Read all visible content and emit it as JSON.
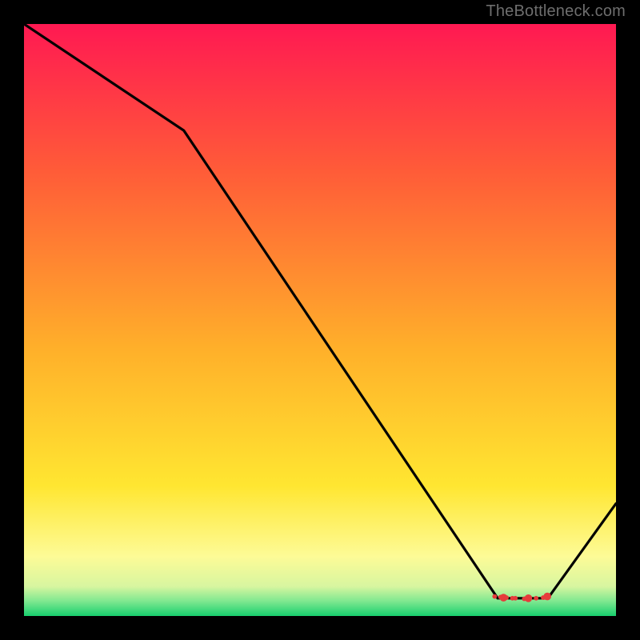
{
  "attribution": "TheBottleneck.com",
  "chart_data": {
    "type": "line",
    "title": "",
    "xlabel": "",
    "ylabel": "",
    "xlim": [
      0,
      100
    ],
    "ylim": [
      0,
      100
    ],
    "line": {
      "x": [
        0,
        27,
        80,
        88.5,
        100
      ],
      "values": [
        100,
        82,
        3,
        3,
        19
      ],
      "stroke": "#000000"
    },
    "markers": {
      "x": [
        79.5,
        80.5,
        81,
        81.5,
        82.5,
        83,
        84.5,
        85.2,
        86.5,
        87.7,
        88.4
      ],
      "values": [
        3.3,
        3.2,
        3.1,
        3.1,
        3.0,
        3.0,
        2.9,
        3.0,
        3.0,
        3.1,
        3.3
      ],
      "size_norm": [
        0.6,
        0.6,
        1.0,
        0.6,
        0.6,
        0.6,
        0.6,
        1.0,
        0.6,
        0.6,
        1.0
      ],
      "color": "#e53b3b"
    },
    "gradient_stops": [
      {
        "offset": 0.0,
        "color": "#ff1952"
      },
      {
        "offset": 0.25,
        "color": "#ff5c38"
      },
      {
        "offset": 0.55,
        "color": "#ffb02a"
      },
      {
        "offset": 0.78,
        "color": "#ffe631"
      },
      {
        "offset": 0.9,
        "color": "#fdfb97"
      },
      {
        "offset": 0.95,
        "color": "#d8f6a0"
      },
      {
        "offset": 0.975,
        "color": "#7fe890"
      },
      {
        "offset": 1.0,
        "color": "#18cf6e"
      }
    ]
  }
}
